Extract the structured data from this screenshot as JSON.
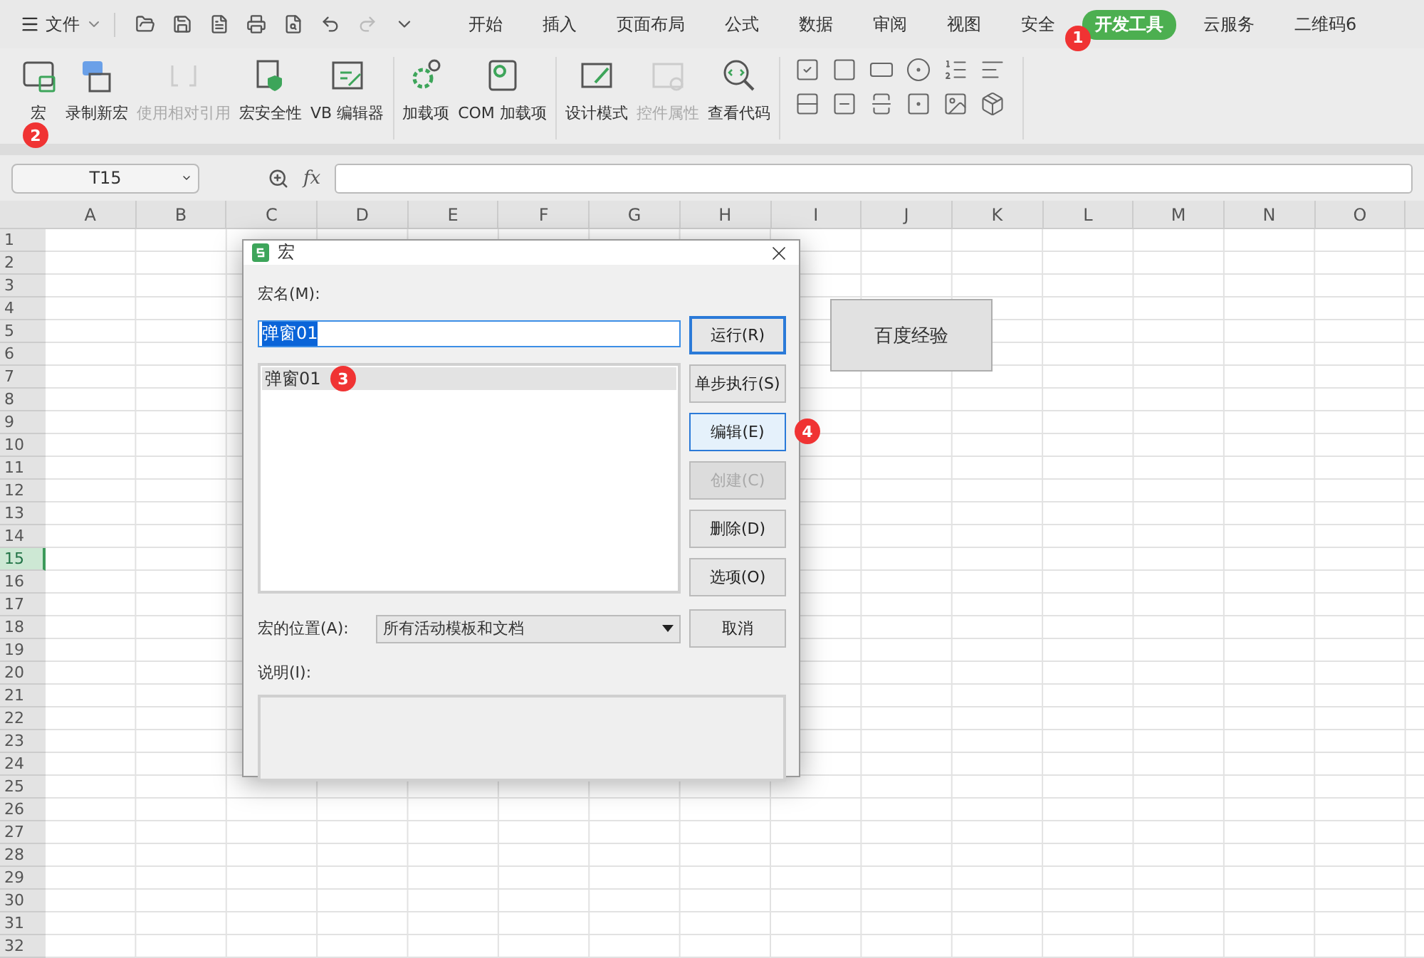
{
  "menu_bar": {
    "file_menu": "文件",
    "tabs": [
      {
        "label": "开始",
        "selected": false
      },
      {
        "label": "插入",
        "selected": false
      },
      {
        "label": "页面布局",
        "selected": false
      },
      {
        "label": "公式",
        "selected": false
      },
      {
        "label": "数据",
        "selected": false
      },
      {
        "label": "审阅",
        "selected": false
      },
      {
        "label": "视图",
        "selected": false
      },
      {
        "label": "安全",
        "selected": false
      },
      {
        "label": "开发工具",
        "selected": true,
        "badge": "1"
      },
      {
        "label": "云服务",
        "selected": false
      },
      {
        "label": "二维码6",
        "selected": false
      }
    ]
  },
  "ribbon": {
    "groups": [
      {
        "items": [
          {
            "label": "宏",
            "disabled": false,
            "badge": "2"
          },
          {
            "label": "录制新宏",
            "disabled": false
          },
          {
            "label": "使用相对引用",
            "disabled": true
          },
          {
            "label": "宏安全性",
            "disabled": false
          },
          {
            "label": "VB 编辑器",
            "disabled": false
          }
        ]
      },
      {
        "items": [
          {
            "label": "加载项",
            "disabled": false
          },
          {
            "label": "COM 加载项",
            "disabled": false
          }
        ]
      },
      {
        "items": [
          {
            "label": "设计模式",
            "disabled": false
          },
          {
            "label": "控件属性",
            "disabled": true
          },
          {
            "label": "查看代码",
            "disabled": false
          }
        ]
      }
    ]
  },
  "formula_bar": {
    "name_box": "T15",
    "fx": "fx"
  },
  "sheet": {
    "columns": [
      "A",
      "B",
      "C",
      "D",
      "E",
      "F",
      "G",
      "H",
      "I",
      "J",
      "K",
      "L",
      "M",
      "N",
      "O"
    ],
    "rows": [
      {
        "label": "1",
        "selected": false
      },
      {
        "label": "2",
        "selected": false
      },
      {
        "label": "3",
        "selected": false
      },
      {
        "label": "4",
        "selected": false
      },
      {
        "label": "5",
        "selected": false
      },
      {
        "label": "6",
        "selected": false
      },
      {
        "label": "7",
        "selected": false
      },
      {
        "label": "8",
        "selected": false
      },
      {
        "label": "9",
        "selected": false
      },
      {
        "label": "10",
        "selected": false
      },
      {
        "label": "11",
        "selected": false
      },
      {
        "label": "12",
        "selected": false
      },
      {
        "label": "13",
        "selected": false
      },
      {
        "label": "14",
        "selected": false
      },
      {
        "label": "15",
        "selected": true
      },
      {
        "label": "16",
        "selected": false
      },
      {
        "label": "17",
        "selected": false
      },
      {
        "label": "18",
        "selected": false
      },
      {
        "label": "19",
        "selected": false
      },
      {
        "label": "20",
        "selected": false
      },
      {
        "label": "21",
        "selected": false
      },
      {
        "label": "22",
        "selected": false
      },
      {
        "label": "23",
        "selected": false
      },
      {
        "label": "24",
        "selected": false
      },
      {
        "label": "25",
        "selected": false
      },
      {
        "label": "26",
        "selected": false
      },
      {
        "label": "27",
        "selected": false
      },
      {
        "label": "28",
        "selected": false
      },
      {
        "label": "29",
        "selected": false
      },
      {
        "label": "30",
        "selected": false
      },
      {
        "label": "31",
        "selected": false
      },
      {
        "label": "32",
        "selected": false
      }
    ],
    "sheet_button": "百度经验"
  },
  "dialog": {
    "title": "宏",
    "name_label": "宏名(M):",
    "name_value": "弹窗01",
    "macros": [
      {
        "label": "弹窗01",
        "selected": true,
        "badge": "3"
      }
    ],
    "buttons": [
      {
        "label": "运行(R)",
        "kind": "default"
      },
      {
        "label": "单步执行(S)",
        "kind": "normal"
      },
      {
        "label": "编辑(E)",
        "kind": "hover",
        "badge": "4"
      },
      {
        "label": "创建(C)",
        "kind": "disabled"
      },
      {
        "label": "删除(D)",
        "kind": "normal"
      },
      {
        "label": "选项(O)",
        "kind": "normal"
      }
    ],
    "location_label": "宏的位置(A):",
    "location_value": "所有活动模板和文档",
    "cancel_button": "取消",
    "description_label": "说明(I):"
  }
}
